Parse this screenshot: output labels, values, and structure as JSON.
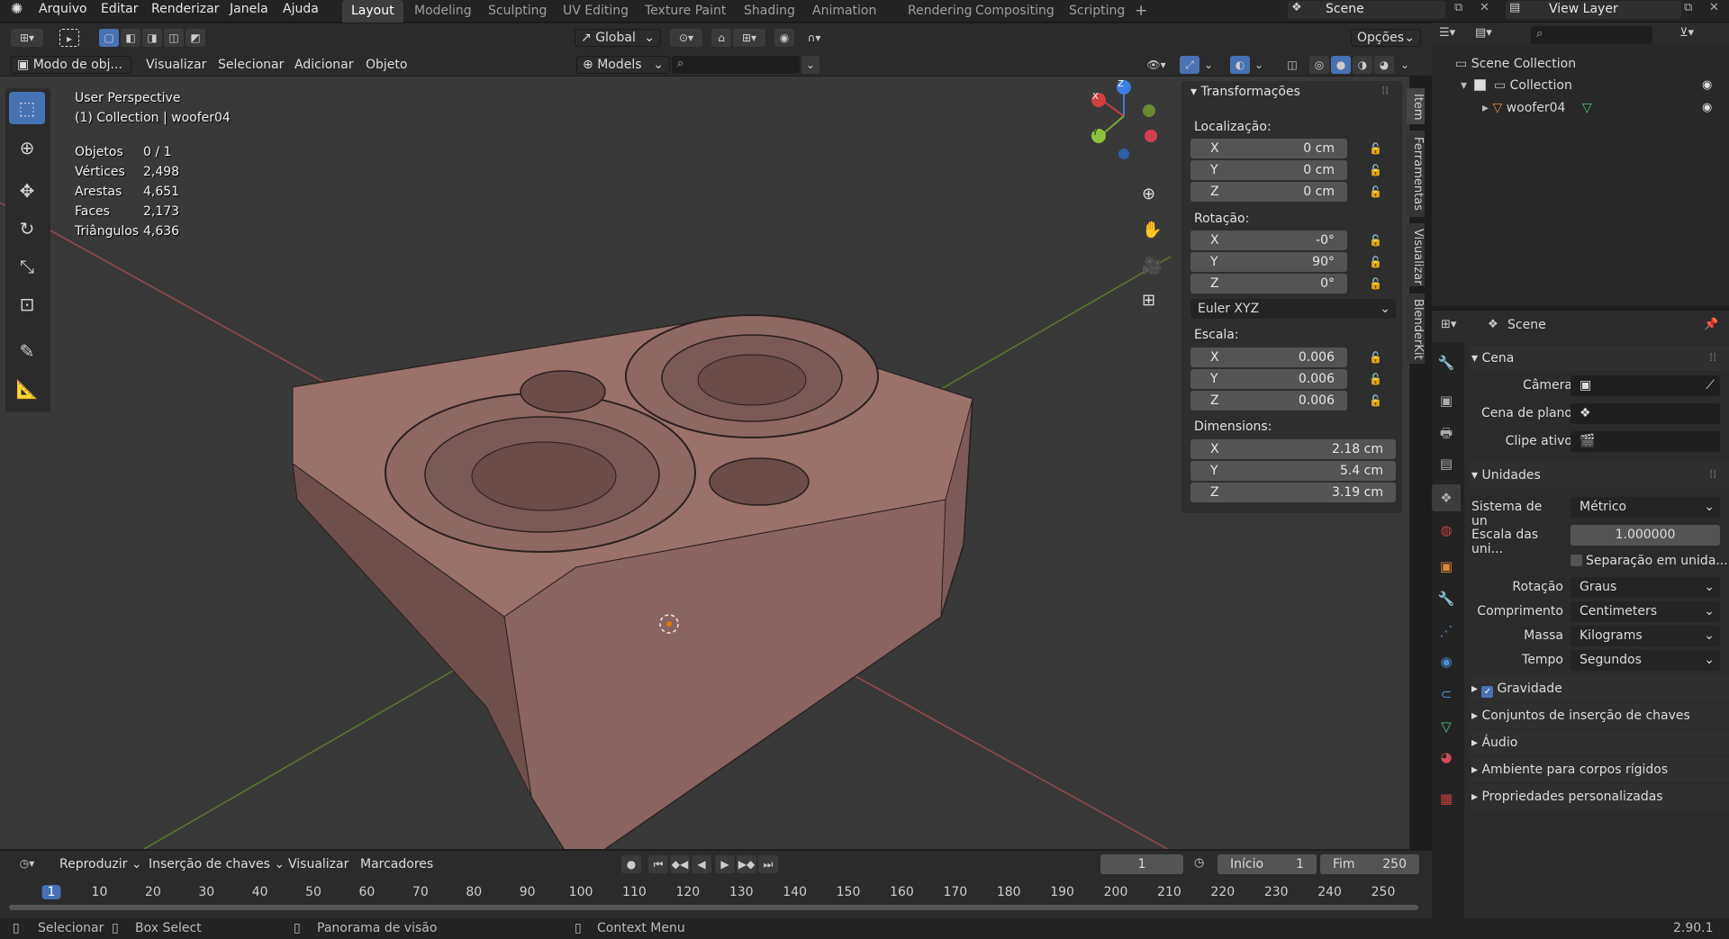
{
  "topbar": {
    "menus": [
      "Arquivo",
      "Editar",
      "Renderizar",
      "Janela",
      "Ajuda"
    ],
    "workspaces": [
      "Layout",
      "Modeling",
      "Sculpting",
      "UV Editing",
      "Texture Paint",
      "Shading",
      "Animation",
      "Rendering",
      "Compositing",
      "Scripting"
    ],
    "active_workspace": "Layout",
    "add_tab": "+",
    "scene_name": "Scene",
    "view_layer": "View Layer"
  },
  "header": {
    "orientation": "Global",
    "options": "Opções",
    "mode": "Modo de obj...",
    "menus": [
      "Visualizar",
      "Selecionar",
      "Adicionar",
      "Objeto"
    ],
    "collection_filter": "Models"
  },
  "viewport": {
    "perspective": "User Perspective",
    "collection_info": "(1) Collection | woofer04",
    "stats": [
      {
        "label": "Objetos",
        "value": "0 / 1"
      },
      {
        "label": "Vértices",
        "value": "2,498"
      },
      {
        "label": "Arestas",
        "value": "4,651"
      },
      {
        "label": "Faces",
        "value": "2,173"
      },
      {
        "label": "Triângulos",
        "value": "4,636"
      }
    ],
    "gizmo": {
      "x": "X",
      "y": "Y",
      "z": "Z"
    }
  },
  "npanel": {
    "title": "Transformações",
    "location_label": "Localização:",
    "location": [
      {
        "axis": "X",
        "value": "0 cm"
      },
      {
        "axis": "Y",
        "value": "0 cm"
      },
      {
        "axis": "Z",
        "value": "0 cm"
      }
    ],
    "rotation_label": "Rotação:",
    "rotation": [
      {
        "axis": "X",
        "value": "-0°"
      },
      {
        "axis": "Y",
        "value": "90°"
      },
      {
        "axis": "Z",
        "value": "0°"
      }
    ],
    "rotation_mode": "Euler XYZ",
    "scale_label": "Escala:",
    "scale": [
      {
        "axis": "X",
        "value": "0.006"
      },
      {
        "axis": "Y",
        "value": "0.006"
      },
      {
        "axis": "Z",
        "value": "0.006"
      }
    ],
    "dimensions_label": "Dimensions:",
    "dimensions": [
      {
        "axis": "X",
        "value": "2.18 cm"
      },
      {
        "axis": "Y",
        "value": "5.4 cm"
      },
      {
        "axis": "Z",
        "value": "3.19 cm"
      }
    ],
    "tabs": [
      "Item",
      "Ferramentas",
      "Visualizar",
      "BlenderKit"
    ]
  },
  "outliner": {
    "scene_collection": "Scene Collection",
    "collection": "Collection",
    "object": "woofer04"
  },
  "properties": {
    "title": "Scene",
    "cena": {
      "header": "Cena",
      "camera_label": "Câmera",
      "background_label": "Cena de plano",
      "clip_label": "Clipe ativo"
    },
    "unidades": {
      "header": "Unidades",
      "system_label": "Sistema de un",
      "system_value": "Métrico",
      "scale_label": "Escala das uni...",
      "scale_value": "1.000000",
      "separate_label": "Separação em unida...",
      "rotation_label": "Rotação",
      "rotation_value": "Graus",
      "length_label": "Comprimento",
      "length_value": "Centimeters",
      "mass_label": "Massa",
      "mass_value": "Kilograms",
      "time_label": "Tempo",
      "time_value": "Segundos"
    },
    "collapsed": [
      "Gravidade",
      "Conjuntos de inserção de chaves",
      "Áudio",
      "Ambiente para corpos rígidos",
      "Propriedades personalizadas"
    ]
  },
  "timeline": {
    "menus": [
      "Reproduzir",
      "Inserção de chaves",
      "Visualizar",
      "Marcadores"
    ],
    "current_frame": "1",
    "start_label": "Início",
    "start_value": "1",
    "end_label": "Fim",
    "end_value": "250",
    "ticks": [
      "1",
      "10",
      "20",
      "30",
      "40",
      "50",
      "60",
      "70",
      "80",
      "90",
      "100",
      "110",
      "120",
      "130",
      "140",
      "150",
      "160",
      "170",
      "180",
      "190",
      "200",
      "210",
      "220",
      "230",
      "240",
      "250"
    ]
  },
  "statusbar": {
    "select": "Selecionar",
    "box_select": "Box Select",
    "pan": "Panorama de visão",
    "context": "Context Menu",
    "version": "2.90.1"
  }
}
